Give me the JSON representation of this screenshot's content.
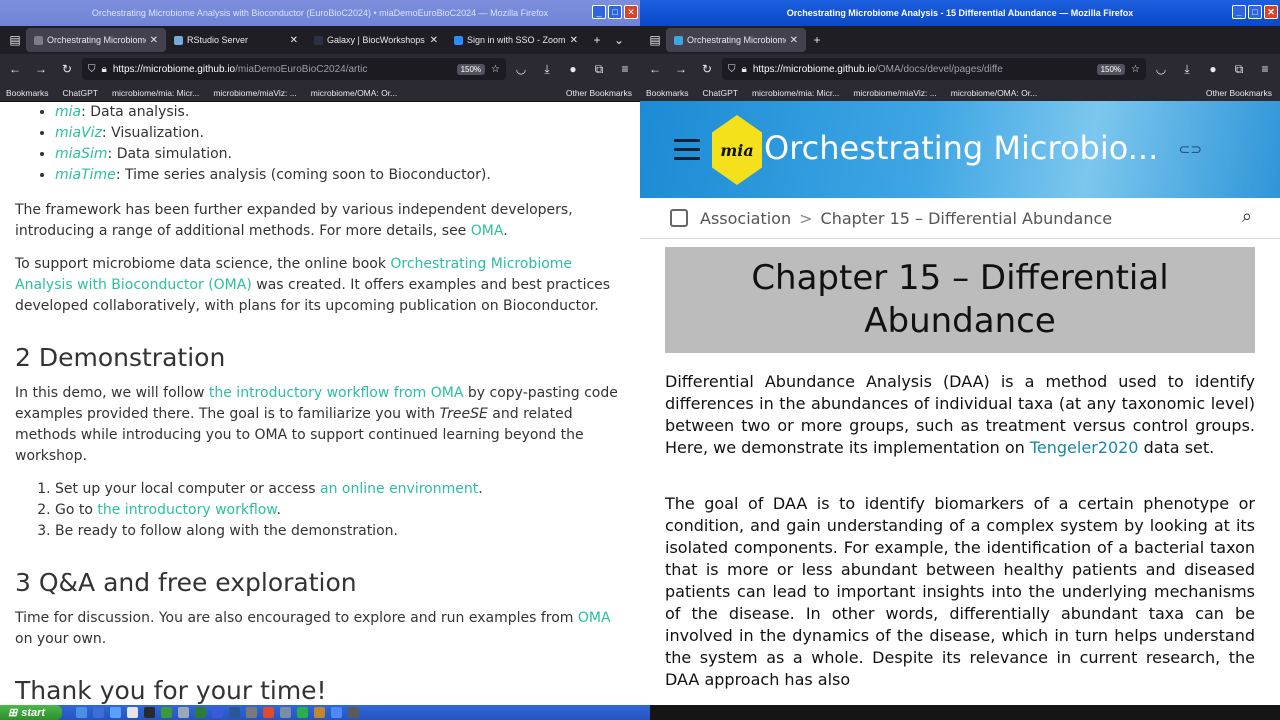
{
  "left_window": {
    "title": "Orchestrating Microbiome Analysis with Bioconductor (EuroBioC2024) • miaDemoEuroBioC2024 — Mozilla Firefox",
    "tabs": [
      {
        "label": "Orchestrating Microbiome A",
        "active": true,
        "favicon_color": "#7b7b8a"
      },
      {
        "label": "RStudio Server",
        "active": false,
        "favicon_color": "#75aadb"
      },
      {
        "label": "Galaxy | BiocWorkshops",
        "active": false,
        "favicon_color": "#2c3143"
      },
      {
        "label": "Sign in with SSO - Zoom",
        "active": false,
        "favicon_color": "#2d8cff"
      }
    ],
    "url_domain": "https://microbiome.github.io",
    "url_path": "/miaDemoEuroBioC2024/artic",
    "zoom": "150%",
    "bookmarks": [
      "Bookmarks",
      "ChatGPT",
      "microbiome/mia: Micr...",
      "microbiome/miaViz: ...",
      "microbiome/OMA: Or..."
    ],
    "other_bookmarks": "Other Bookmarks"
  },
  "right_window": {
    "title": "Orchestrating Microbiome Analysis - 15  Differential Abundance — Mozilla Firefox",
    "tabs": [
      {
        "label": "Orchestrating Microbiome",
        "active": true,
        "favicon_color": "#3fa6e4"
      }
    ],
    "url_domain": "https://microbiome.github.io",
    "url_path": "/OMA/docs/devel/pages/diffe",
    "zoom": "150%",
    "bookmarks": [
      "Bookmarks",
      "ChatGPT",
      "microbiome/mia: Micr...",
      "microbiome/miaViz: ...",
      "microbiome/OMA: Or..."
    ],
    "other_bookmarks": "Other Bookmarks"
  },
  "left_page": {
    "bullets": [
      {
        "name": "mia",
        "desc": ": Data analysis."
      },
      {
        "name": "miaViz",
        "desc": ": Visualization."
      },
      {
        "name": "miaSim",
        "desc": ": Data simulation."
      },
      {
        "name": "miaTime",
        "desc": ": Time series analysis (coming soon to Bioconductor)."
      }
    ],
    "p1_text": "The framework has been further expanded by various independent developers, introducing a range of additional methods. For more details, see ",
    "p1_link": "OMA",
    "p1_end": ".",
    "p2_text": "To support microbiome data science, the online book ",
    "p2_link": "Orchestrating Microbiome Analysis with Bioconductor (OMA)",
    "p2_end": " was created. It offers examples and best practices developed collaboratively, with plans for its upcoming publication on Bioconductor.",
    "h2_demo": "2 Demonstration",
    "p3_a": "In this demo, we will follow ",
    "p3_link": "the introductory workflow from OMA",
    "p3_b": " by copy-pasting code examples provided there. The goal is to familiarize you with ",
    "p3_em": "TreeSE",
    "p3_c": " and related methods while introducing you to OMA to support continued learning beyond the workshop.",
    "steps": [
      {
        "a": "Set up your local computer or access ",
        "link": "an online environment",
        "b": "."
      },
      {
        "a": "Go to ",
        "link": "the introductory workflow",
        "b": "."
      },
      {
        "a": "Be ready to follow along with the demonstration.",
        "link": "",
        "b": ""
      }
    ],
    "h2_qa": "3 Q&A and free exploration",
    "p4_a": "Time for discussion. You are also encouraged to explore and run examples from ",
    "p4_link": "OMA",
    "p4_b": " on your own.",
    "h2_thanks": "Thank you for your time!"
  },
  "right_page": {
    "logo_text": "mia",
    "banner_title": "Orchestrating Microbio...",
    "crumb_1": "Association",
    "crumb_sep": ">",
    "crumb_2": "Chapter 15 –  Differential Abundance",
    "chapter_title": "Chapter 15 –  Differential Abundance",
    "p1_a": "Differential Abundance Analysis (DAA) is a method used to identify differences in the abundances of individual taxa (at any taxonomic level) between two or more groups, such as treatment versus control groups. Here, we demonstrate its implementation on ",
    "p1_link": "Tengeler2020",
    "p1_b": " data set.",
    "p2": "The goal of DAA is to identify biomarkers of a certain phenotype or condition, and gain understanding of a complex system by looking at its isolated components. For example, the identification of a bacterial taxon that is more or less abundant between healthy patients and diseased patients can lead to important insights into the underlying mechanisms of the disease. In other words, differentially abundant taxa can be involved in the dynamics of the disease, which in turn helps understand the system as a whole. Despite its relevance in current research, the DAA approach has also"
  },
  "taskbar": {
    "start_label": "start",
    "tray_colors": [
      "#4a90e2",
      "#3b6fd4",
      "#5aa0ff",
      "#e5e5e5",
      "#2a2a2a",
      "#3c9a3c",
      "#9aa8b8",
      "#2f7d32",
      "#3b5bdb",
      "#2b579a",
      "#7a7a7a",
      "#e04a2e",
      "#7a8ca8",
      "#27b04b",
      "#c4852f",
      "#4d88ff",
      "#5a5a5a"
    ]
  }
}
